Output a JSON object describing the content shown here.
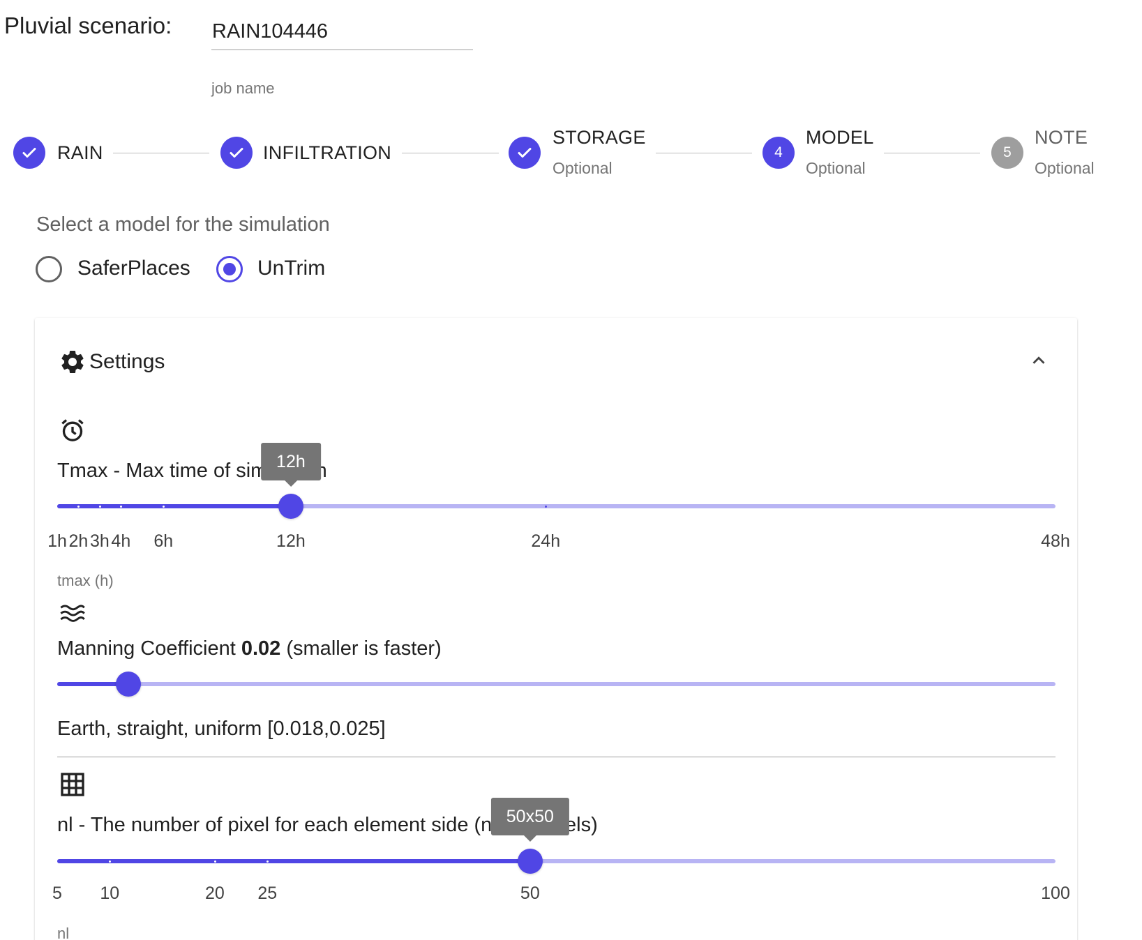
{
  "header": {
    "title": "Pluvial scenario:",
    "job_name_value": "RAIN104446",
    "job_name_hint": "job name"
  },
  "stepper": {
    "steps": [
      {
        "label": "RAIN",
        "state": "complete"
      },
      {
        "label": "INFILTRATION",
        "state": "complete"
      },
      {
        "label": "STORAGE",
        "sub": "Optional",
        "state": "complete"
      },
      {
        "label": "MODEL",
        "sub": "Optional",
        "number": "4",
        "state": "active"
      },
      {
        "label": "NOTE",
        "sub": "Optional",
        "number": "5",
        "state": "inactive"
      }
    ]
  },
  "model": {
    "prompt": "Select a model for the simulation",
    "options": [
      {
        "label": "SaferPlaces",
        "checked": false
      },
      {
        "label": "UnTrim",
        "checked": true
      }
    ]
  },
  "settings": {
    "title": "Settings",
    "tmax": {
      "label": "Tmax - Max time of simulation",
      "value_label": "12h",
      "value": 12,
      "min": 1,
      "max": 48,
      "marks": [
        "1h",
        "2h",
        "3h",
        "4h",
        "6h",
        "12h",
        "24h",
        "48h"
      ],
      "mark_values": [
        1,
        2,
        3,
        4,
        6,
        12,
        24,
        48
      ],
      "hint": "tmax (h)"
    },
    "manning": {
      "label_prefix": "Manning Coefficient ",
      "value": "0.02",
      "label_suffix": " (smaller is faster)",
      "value_num": 0.02,
      "min": 0.01,
      "max": 0.15,
      "description": "Earth, straight, uniform [0.018,0.025]"
    },
    "nl": {
      "label": "nl - The number of pixel for each element side (nl x nl pixels)",
      "value_label": "50x50",
      "value": 50,
      "min": 5,
      "max": 100,
      "marks": [
        "5",
        "10",
        "20",
        "25",
        "50",
        "100"
      ],
      "mark_values": [
        5,
        10,
        20,
        25,
        50,
        100
      ],
      "hint": "nl"
    }
  },
  "colors": {
    "accent": "#5046e5",
    "track_light": "#b8b4f4",
    "inactive": "#9e9e9e"
  }
}
